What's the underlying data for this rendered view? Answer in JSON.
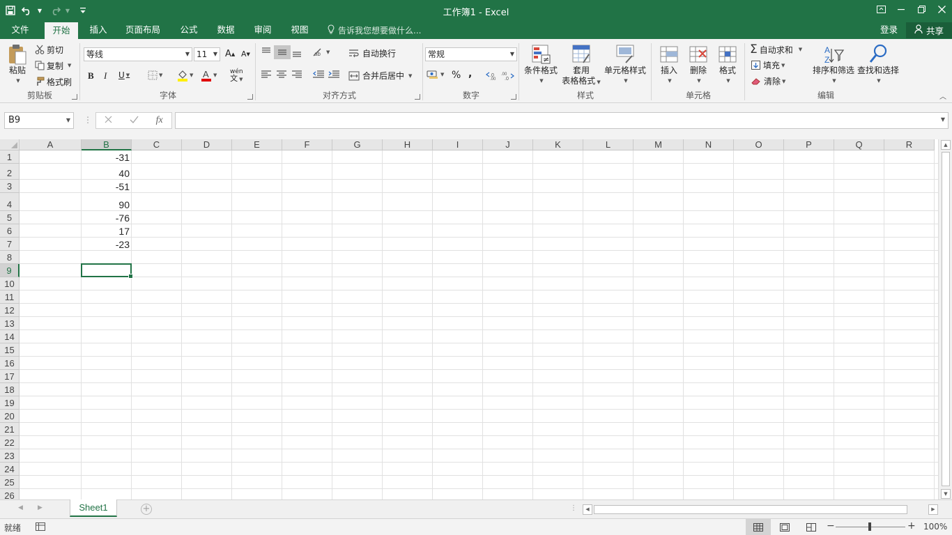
{
  "window": {
    "title": "工作簿1 - Excel"
  },
  "tabs": {
    "items": [
      {
        "id": "file",
        "label": "文件"
      },
      {
        "id": "home",
        "label": "开始",
        "active": true
      },
      {
        "id": "insert",
        "label": "插入"
      },
      {
        "id": "pagelayout",
        "label": "页面布局"
      },
      {
        "id": "formulas",
        "label": "公式"
      },
      {
        "id": "data",
        "label": "数据"
      },
      {
        "id": "review",
        "label": "审阅"
      },
      {
        "id": "view",
        "label": "视图"
      }
    ],
    "tell_me": "告诉我您想要做什么...",
    "login": "登录",
    "share": "共享"
  },
  "ribbon": {
    "clipboard": {
      "label": "剪贴板",
      "paste": "粘贴",
      "cut": "剪切",
      "copy": "复制",
      "format_painter": "格式刷"
    },
    "font": {
      "label": "字体",
      "font_name": "等线",
      "font_size": "11",
      "wen": "wén"
    },
    "alignment": {
      "label": "对齐方式",
      "wrap_text": "自动换行",
      "merge_center": "合并后居中"
    },
    "number": {
      "label": "数字",
      "format": "常规"
    },
    "styles": {
      "label": "样式",
      "conditional": "条件格式",
      "table_line1": "套用",
      "table_line2": "表格格式",
      "cell_styles": "单元格样式"
    },
    "cells": {
      "label": "单元格",
      "insert": "插入",
      "delete": "删除",
      "format": "格式"
    },
    "editing": {
      "label": "编辑",
      "autosum": "自动求和",
      "fill": "填充",
      "clear": "清除",
      "sort_filter": "排序和筛选",
      "find_select": "查找和选择"
    }
  },
  "formula_bar": {
    "name_box": "B9",
    "formula": ""
  },
  "sheet": {
    "columns": [
      "A",
      "B",
      "C",
      "D",
      "E",
      "F",
      "G",
      "H",
      "I",
      "J",
      "K",
      "L",
      "M",
      "N",
      "O",
      "P",
      "Q",
      "R"
    ],
    "selected_column": "B",
    "rows": [
      "1",
      "2",
      "3",
      "4",
      "5",
      "6",
      "7",
      "8",
      "9",
      "10",
      "11",
      "12",
      "13",
      "14",
      "15",
      "16",
      "17",
      "18",
      "19",
      "20",
      "21",
      "22",
      "23",
      "24",
      "25",
      "26"
    ],
    "selected_row": "9",
    "column_b_values": [
      "-31",
      "40",
      "-51",
      "90",
      "-76",
      "17",
      "-23"
    ],
    "active_cell": "B9"
  },
  "sheet_tabs": {
    "active": "Sheet1"
  },
  "status": {
    "ready": "就绪",
    "zoom": "100%"
  },
  "colors": {
    "accent": "#217346",
    "ribbon_bg": "#f3f3f3",
    "grid_line": "#e1e1e1"
  }
}
